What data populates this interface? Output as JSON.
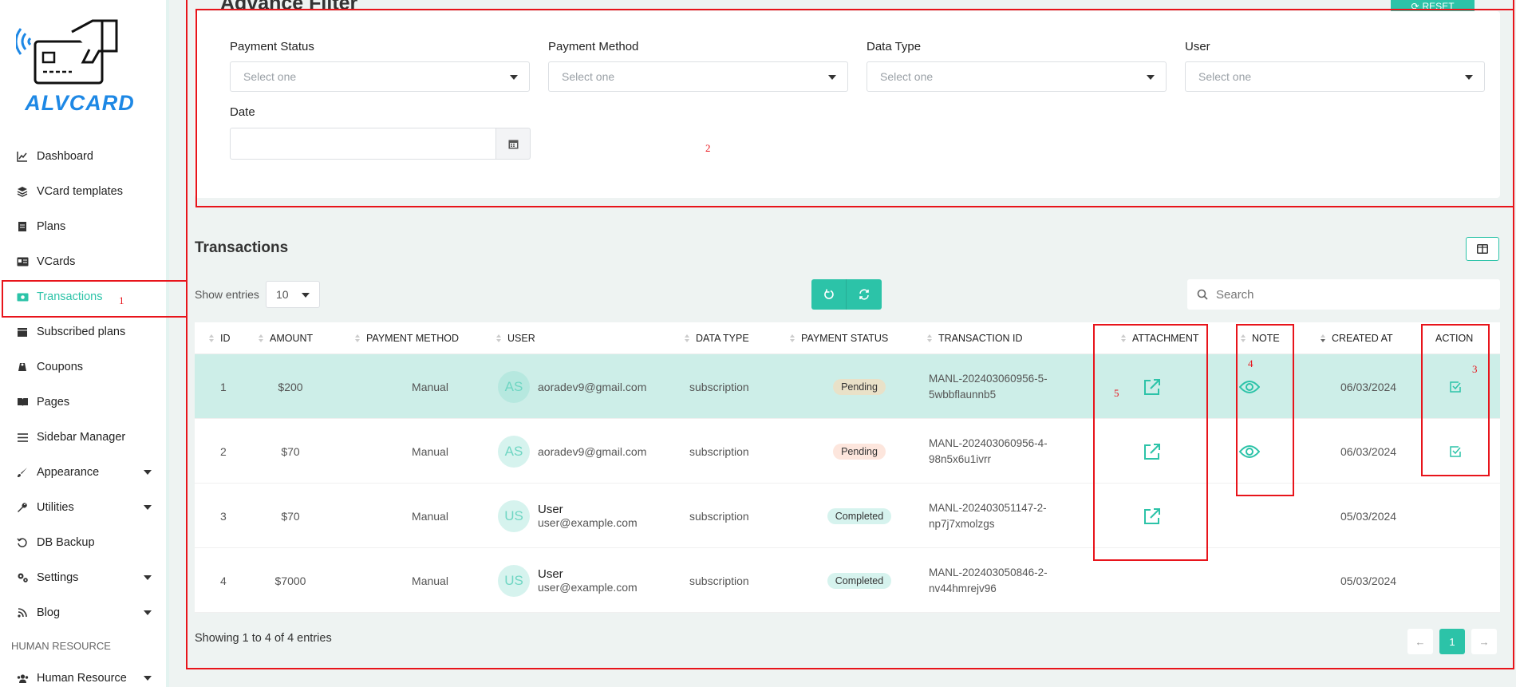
{
  "brand": {
    "logo_text": "ALVCARD"
  },
  "sidebar": {
    "items": [
      {
        "label": "Dashboard",
        "icon": "chart-line-icon"
      },
      {
        "label": "VCard templates",
        "icon": "layers-icon"
      },
      {
        "label": "Plans",
        "icon": "document-icon"
      },
      {
        "label": "VCards",
        "icon": "id-card-icon"
      },
      {
        "label": "Transactions",
        "icon": "money-icon",
        "active": true
      },
      {
        "label": "Subscribed plans",
        "icon": "inbox-icon"
      },
      {
        "label": "Coupons",
        "icon": "coupon-icon"
      },
      {
        "label": "Pages",
        "icon": "book-icon"
      },
      {
        "label": "Sidebar Manager",
        "icon": "menu-icon"
      },
      {
        "label": "Appearance",
        "icon": "brush-icon",
        "has_submenu": true
      },
      {
        "label": "Utilities",
        "icon": "wrench-icon",
        "has_submenu": true
      },
      {
        "label": "DB Backup",
        "icon": "history-icon"
      },
      {
        "label": "Settings",
        "icon": "cogs-icon",
        "has_submenu": true
      },
      {
        "label": "Blog",
        "icon": "blog-icon",
        "has_submenu": true
      }
    ],
    "section_label": "HUMAN RESOURCE",
    "hr_item": {
      "label": "Human Resource",
      "icon": "users-icon",
      "has_submenu": true
    }
  },
  "page": {
    "title": "Advance Filter",
    "reset_label": "RESET"
  },
  "filters": {
    "payment_status": {
      "label": "Payment Status",
      "placeholder": "Select one"
    },
    "payment_method": {
      "label": "Payment Method",
      "placeholder": "Select one"
    },
    "data_type": {
      "label": "Data Type",
      "placeholder": "Select one"
    },
    "user": {
      "label": "User",
      "placeholder": "Select one"
    },
    "date": {
      "label": "Date",
      "value": ""
    }
  },
  "transactions": {
    "title": "Transactions",
    "show_entries_label": "Show entries",
    "entries_value": "10",
    "search_placeholder": "Search",
    "columns": [
      "ID",
      "AMOUNT",
      "PAYMENT METHOD",
      "USER",
      "DATA TYPE",
      "PAYMENT STATUS",
      "TRANSACTION ID",
      "ATTACHMENT",
      "NOTE",
      "CREATED AT",
      "ACTION"
    ],
    "rows": [
      {
        "id": "1",
        "amount": "$200",
        "method": "Manual",
        "initials": "AS",
        "user_name": "",
        "email": "aoradev9@gmail.com",
        "data_type": "subscription",
        "status": "Pending",
        "txid_line1": "MANL-202403060956-5-",
        "txid_line2": "5wbbflaunnb5",
        "attachment": true,
        "note": true,
        "created": "06/03/2024",
        "action": true
      },
      {
        "id": "2",
        "amount": "$70",
        "method": "Manual",
        "initials": "AS",
        "user_name": "",
        "email": "aoradev9@gmail.com",
        "data_type": "subscription",
        "status": "Pending",
        "txid_line1": "MANL-202403060956-4-",
        "txid_line2": "98n5x6u1ivrr",
        "attachment": true,
        "note": true,
        "created": "06/03/2024",
        "action": true
      },
      {
        "id": "3",
        "amount": "$70",
        "method": "Manual",
        "initials": "US",
        "user_name": "User",
        "email": "user@example.com",
        "data_type": "subscription",
        "status": "Completed",
        "txid_line1": "MANL-202403051147-2-",
        "txid_line2": "np7j7xmolzgs",
        "attachment": true,
        "note": false,
        "created": "05/03/2024",
        "action": false
      },
      {
        "id": "4",
        "amount": "$7000",
        "method": "Manual",
        "initials": "US",
        "user_name": "User",
        "email": "user@example.com",
        "data_type": "subscription",
        "status": "Completed",
        "txid_line1": "MANL-202403050846-2-",
        "txid_line2": "nv44hmrejv96",
        "attachment": false,
        "note": false,
        "created": "05/03/2024",
        "action": false
      }
    ],
    "footer": "Showing 1 to 4 of 4 entries",
    "pagination": {
      "prev": "←",
      "current": "1",
      "next": "→"
    }
  },
  "annotations": [
    "1",
    "2",
    "3",
    "4",
    "5"
  ],
  "colors": {
    "accent": "#2cc3a8",
    "annotation": "#e8141b",
    "highlight_row": "#cdeee8"
  }
}
